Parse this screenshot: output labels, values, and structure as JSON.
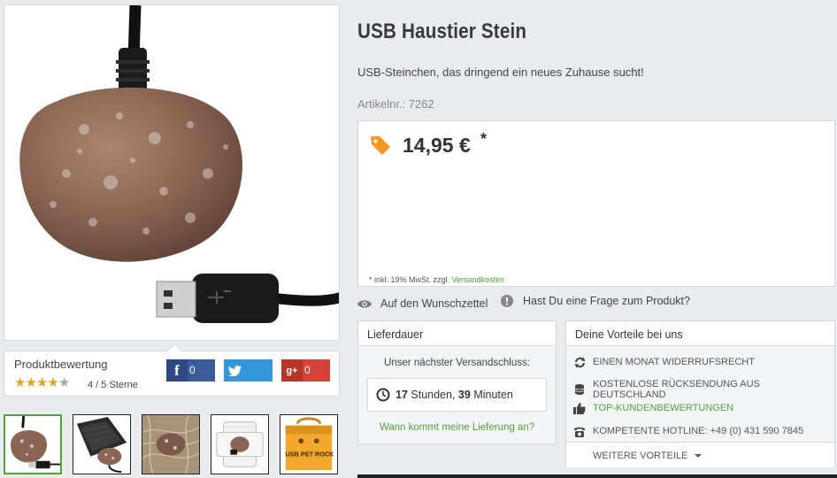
{
  "product": {
    "title": "USB Haustier Stein",
    "description": "USB-Steinchen, das dringend ein neues Zuhause sucht!",
    "article_number": "Artikelnr.: 7262",
    "price": "14,95 €",
    "price_asterisk": "*",
    "tax_note": "* inkl. 19% MwSt. zzgl.",
    "shipping_costs_link": "Versandkosten"
  },
  "rating": {
    "label": "Produktbewertung",
    "value": 4,
    "max": 5,
    "text": "4 / 5 Sterne"
  },
  "share": {
    "facebook_count": "0",
    "googleplus_count": "0",
    "googleplus_icon": "g+"
  },
  "actions": {
    "wishlist": "Auf den Wunschzettel",
    "question": "Hast Du eine Frage zum Produkt?"
  },
  "delivery": {
    "header": "Lieferdauer",
    "next_shipping": "Unser nächster Versandschluss:",
    "hours_value": "17",
    "hours_unit": "Stunden,",
    "minutes_value": "39",
    "minutes_unit": "Minuten",
    "when_link": "Wann kommt meine Lieferung an?"
  },
  "benefits": {
    "header": "Deine Vorteile bei uns",
    "items": [
      {
        "label": "Einen Monat Widerrufsrecht",
        "icon": "refresh-icon",
        "highlight": false
      },
      {
        "label": "Kostenlose Rücksendung aus Deutschland",
        "icon": "coins-icon",
        "highlight": false
      },
      {
        "label": "Top-Kundenbewertungen",
        "icon": "thumbs-up-icon",
        "highlight": true
      },
      {
        "label": "Kompetente Hotline: +49 (0) 431 590 7845",
        "icon": "phone-icon",
        "highlight": false
      }
    ],
    "more": "Weitere Vorteile"
  },
  "thumbnails": {
    "active_index": 0,
    "thumb5_text": "USB PET ROCK"
  },
  "colors": {
    "accent_green": "#53a13a",
    "price_tag_orange": "#f5961e",
    "star_gold": "#e8a020",
    "facebook": "#3b5a9a",
    "twitter": "#3397d9",
    "googleplus": "#d64236"
  }
}
